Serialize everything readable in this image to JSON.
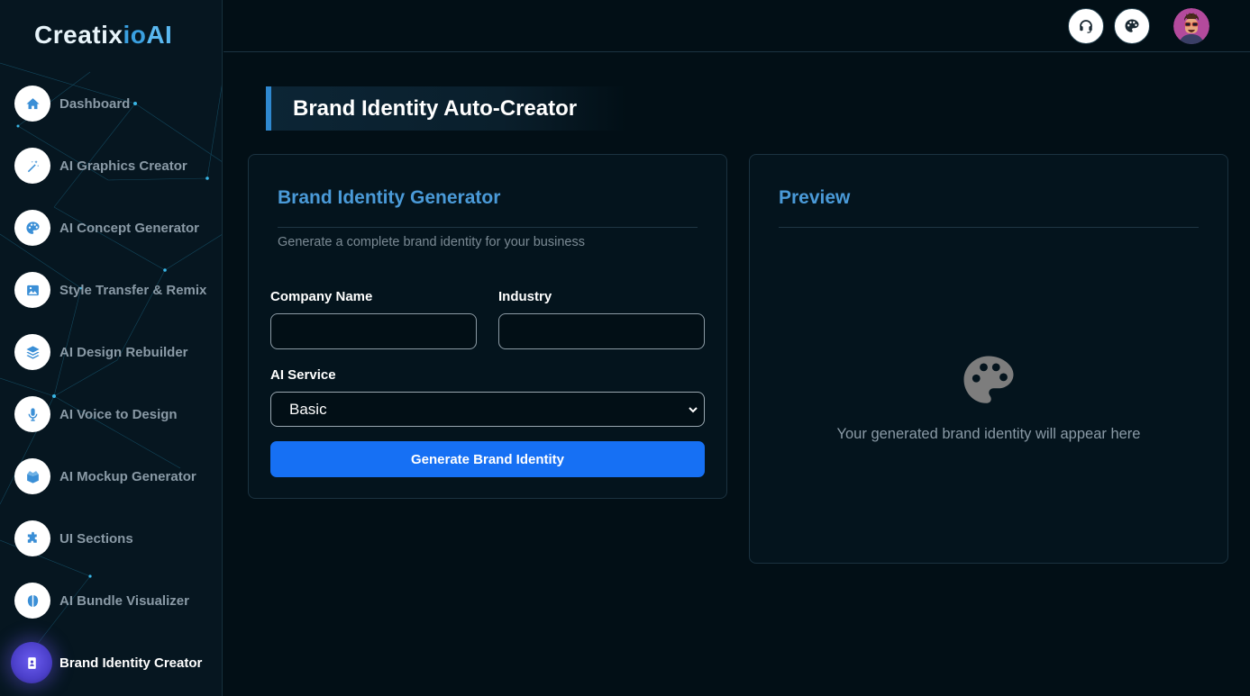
{
  "app": {
    "logo_part1": "Creatix",
    "logo_part2": "io",
    "logo_part3": "AI"
  },
  "sidebar": {
    "items": [
      {
        "label": "Dashboard",
        "icon": "home-icon"
      },
      {
        "label": "AI Graphics Creator",
        "icon": "magic-wand-icon"
      },
      {
        "label": "AI Concept Generator",
        "icon": "palette-icon"
      },
      {
        "label": "Style Transfer & Remix",
        "icon": "image-icon"
      },
      {
        "label": "AI Design Rebuilder",
        "icon": "layers-icon"
      },
      {
        "label": "AI Voice to Design",
        "icon": "microphone-icon"
      },
      {
        "label": "AI Mockup Generator",
        "icon": "box-open-icon"
      },
      {
        "label": "UI Sections",
        "icon": "puzzle-icon"
      },
      {
        "label": "AI Bundle Visualizer",
        "icon": "brain-icon"
      },
      {
        "label": "Brand Identity Creator",
        "icon": "id-badge-icon",
        "active": true
      }
    ]
  },
  "topbar": {
    "support_icon": "headset-icon",
    "theme_icon": "palette-icon",
    "avatar_icon": "avatar"
  },
  "main": {
    "page_title": "Brand Identity Auto-Creator",
    "generator": {
      "title": "Brand Identity Generator",
      "subtitle": "Generate a complete brand identity for your business",
      "company_label": "Company Name",
      "company_value": "",
      "industry_label": "Industry",
      "industry_value": "",
      "service_label": "AI Service",
      "service_selected": "Basic",
      "button_label": "Generate Brand Identity"
    },
    "preview": {
      "title": "Preview",
      "icon": "palette-icon",
      "empty_text": "Your generated brand identity will appear here"
    }
  },
  "colors": {
    "accent": "#4a9ad8",
    "primary_button": "#1670f4",
    "active_nav": "#5a4de0",
    "background": "#020f16"
  }
}
